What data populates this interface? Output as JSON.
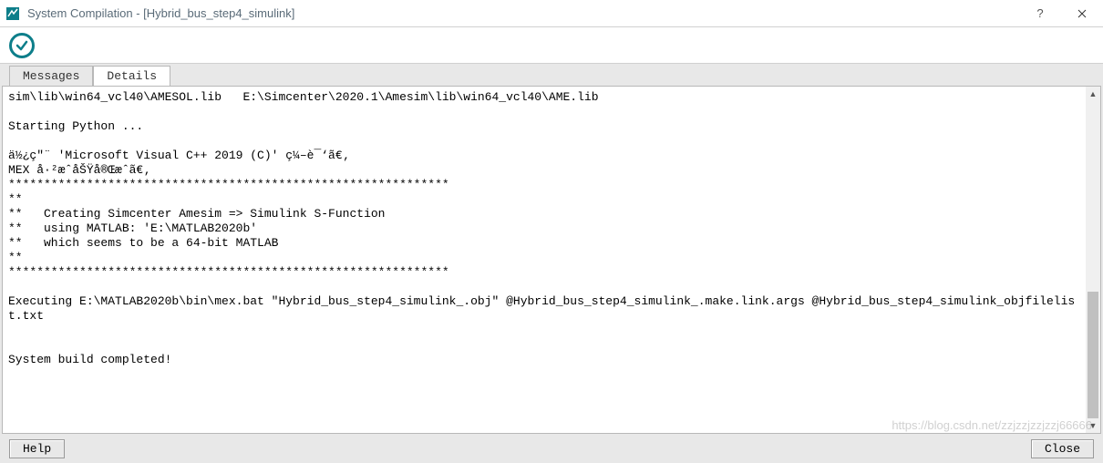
{
  "window": {
    "title": "System Compilation - [Hybrid_bus_step4_simulink]"
  },
  "tabs": {
    "messages": "Messages",
    "details": "Details",
    "active": "details"
  },
  "log": "sim\\lib\\win64_vcl40\\AMESOL.lib   E:\\Simcenter\\2020.1\\Amesim\\lib\\win64_vcl40\\AME.lib\n\nStarting Python ...\n\nä½¿ç\"¨ 'Microsoft Visual C++ 2019 (C)' ç¼–è¯‘ã€‚\nMEX å·²æˆåŠŸå®Œæˆã€‚\n**************************************************************\n**\n**   Creating Simcenter Amesim => Simulink S-Function\n**   using MATLAB: 'E:\\MATLAB2020b'\n**   which seems to be a 64-bit MATLAB\n**\n**************************************************************\n\nExecuting E:\\MATLAB2020b\\bin\\mex.bat \"Hybrid_bus_step4_simulink_.obj\" @Hybrid_bus_step4_simulink_.make.link.args @Hybrid_bus_step4_simulink_objfilelist.txt\n\n\nSystem build completed!",
  "buttons": {
    "help": "Help",
    "close": "Close"
  },
  "watermark": "https://blog.csdn.net/zzjzzjzzjzzj66666"
}
